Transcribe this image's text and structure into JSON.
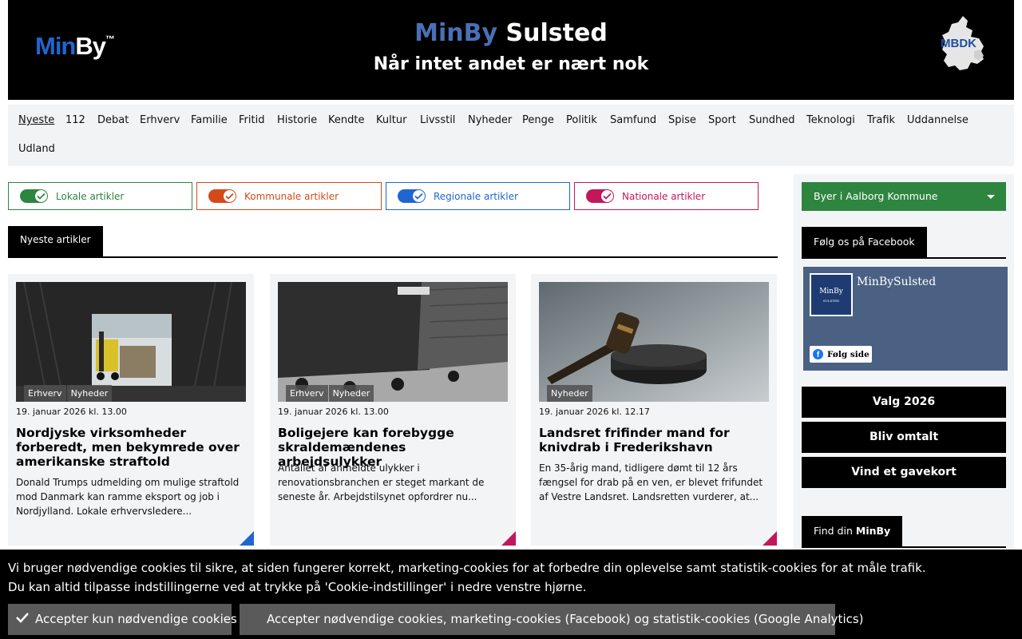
{
  "header": {
    "logo_min": "MinBy",
    "logo_by": "",
    "logo_tm": "™",
    "title_prefix": "MinBy",
    "title_city": "Sulsted",
    "tagline": "Når intet andet er nært nok",
    "mbdk_label": "MBDK"
  },
  "nav": {
    "row1": [
      "Nyeste",
      "112",
      "Debat",
      "Erhverv",
      "Familie",
      "Fritid",
      "Historie",
      "Kendte",
      "Kultur",
      "Livsstil",
      "Nyheder",
      "Penge",
      "Politik",
      "Samfund",
      "Spise",
      "Sport",
      "Sundhed",
      "Teknologi",
      "Trafik",
      "Uddannelse"
    ],
    "row2": [
      "Udland"
    ],
    "active": "Nyeste"
  },
  "filters": [
    {
      "label": "Lokale artikler",
      "color": "#2e8540"
    },
    {
      "label": "Kommunale artikler",
      "color": "#d4491c"
    },
    {
      "label": "Regionale artikler",
      "color": "#1f66d1"
    },
    {
      "label": "Nationale artikler",
      "color": "#c2185b"
    }
  ],
  "section": {
    "title": "Nyeste artikler"
  },
  "articles": [
    {
      "tags": [
        "Erhverv",
        "Nyheder"
      ],
      "date": "19. januar 2026 kl. 13.00",
      "title": "Nordjyske virksomheder forberedt, men bekymrede over amerikanske straftold",
      "text": "Donald Trumps udmelding om mulige straftold mod Danmark kan ramme eksport og job i Nordjylland. Lokale erhvervsledere...",
      "corner_color": "#1f66d1"
    },
    {
      "tags": [
        "Erhverv",
        "Nyheder"
      ],
      "date": "19. januar 2026 kl. 13.00",
      "title": "Boligejere kan forebygge skraldemændenes arbejdsulykker",
      "text": "Antallet af anmeldte ulykker i renovationsbranchen er steget markant de seneste år. Arbejdstilsynet opfordrer nu...",
      "corner_color": "#c2185b"
    },
    {
      "tags": [
        "Nyheder"
      ],
      "date": "19. januar 2026 kl. 12.17",
      "title": "Landsret frifinder mand for knivdrab i Frederikshavn",
      "text": "En 35-årig mand, tidligere dømt til 12 års fængsel for drab på en ven, er blevet frifundet af Vestre Landsret. Landsretten vurderer, at...",
      "corner_color": "#c2185b"
    }
  ],
  "sidebar": {
    "city_select": "Byer i Aalborg Kommune",
    "facebook_tab": "Følg os på Facebook",
    "fb_page_name": "MinBySulsted",
    "fb_avatar_text": "MinBy",
    "fb_avatar_sub": "SULSTED",
    "fb_follow": "Følg side",
    "buttons": [
      "Valg 2026",
      "Bliv omtalt",
      "Vind et gavekort"
    ],
    "find_tab_prefix": "Find din",
    "find_tab_brand": "MinBy"
  },
  "cookie": {
    "line1": "Vi bruger nødvendige cookies til sikre, at siden fungerer korrekt, marketing-cookies for at forbedre din oplevelse samt statistik-cookies for at måle trafik.",
    "line2": "Du kan altid tilpasse indstillingerne ved at trykke på 'Cookie-indstillinger' i nedre venstre hjørne.",
    "btn_necessary": "Accepter kun nødvendige cookies",
    "btn_all": "Accepter nødvendige cookies, marketing-cookies (Facebook) og statistik-cookies (Google Analytics)"
  }
}
